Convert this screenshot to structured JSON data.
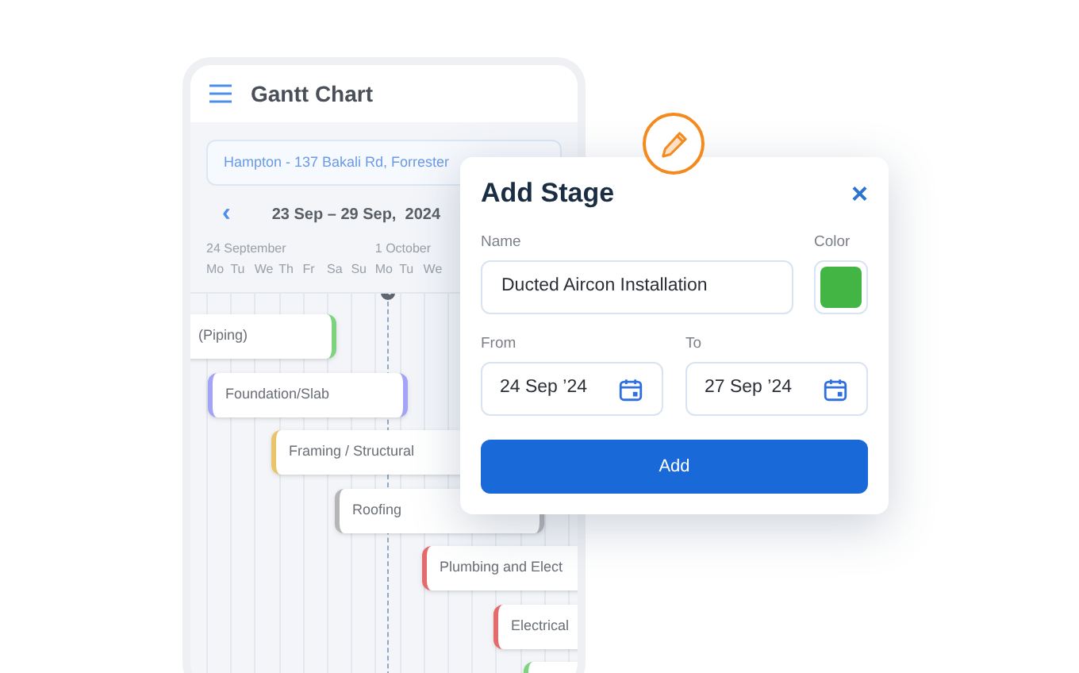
{
  "app": {
    "title": "Gantt Chart"
  },
  "project": {
    "value": "Hampton - 137 Bakali Rd, Forrester"
  },
  "date_range": {
    "prev": "‹",
    "label": "23 Sep – 29 Sep,  2024"
  },
  "weeks": [
    "24 September",
    "1 October"
  ],
  "days": [
    "Mo",
    "Tu",
    "We",
    "Th",
    "Fr",
    "Sa",
    "Su",
    "Mo",
    "Tu",
    "We"
  ],
  "bars": [
    {
      "label": "(Piping)",
      "color": "#7fd37f"
    },
    {
      "label": "Foundation/Slab",
      "color": "#a3a3f7"
    },
    {
      "label": "Framing / Structural",
      "color": "#e9c46a"
    },
    {
      "label": "Roofing",
      "color": "#b5b5b5"
    },
    {
      "label": "Plumbing and Elect",
      "color": "#e36b6b"
    },
    {
      "label": "Electrical",
      "color": "#e36b6b"
    },
    {
      "color": "#7fd37f"
    }
  ],
  "dialog": {
    "title": "Add Stage",
    "close": "×",
    "name_label": "Name",
    "name_value": "Ducted Aircon Installation",
    "color_label": "Color",
    "color": "#42b544",
    "from_label": "From",
    "from_value": "24 Sep ’24",
    "to_label": "To",
    "to_value": "27 Sep ’24",
    "submit": "Add"
  }
}
